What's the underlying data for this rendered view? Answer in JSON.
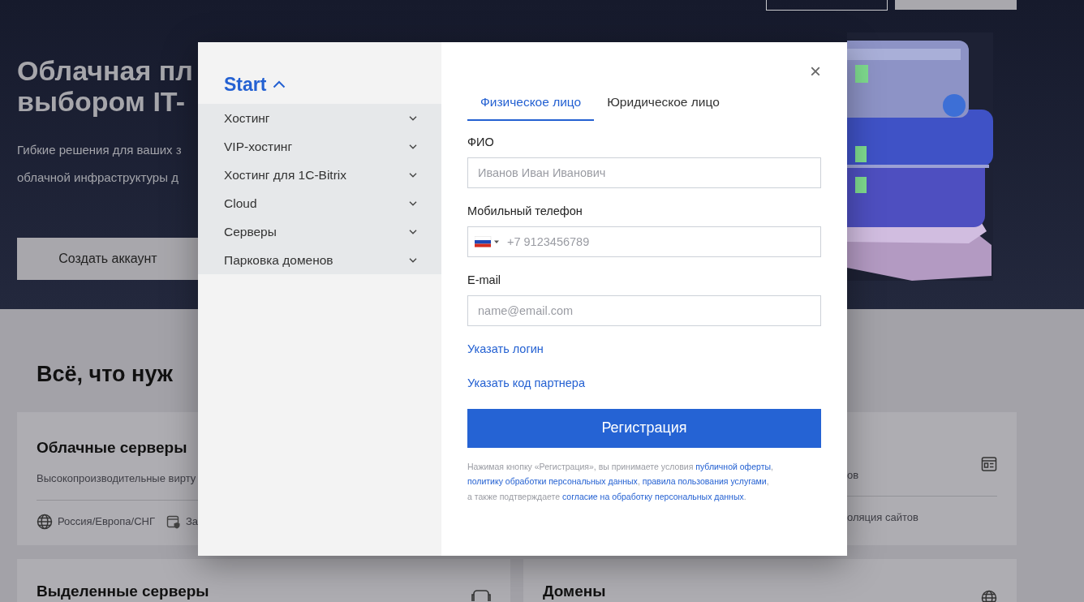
{
  "hero": {
    "title_lines": [
      "Облачная пл",
      "выбором IT-"
    ],
    "text_lines": [
      "Гибкие решения для ваших з",
      "облачной инфраструктуры д"
    ],
    "button": "Создать аккаунт"
  },
  "section": {
    "title": "Всё, что нуж",
    "cards": [
      {
        "title": "Облачные серверы",
        "description": "Высокопроизводительные вирту",
        "features": [
          {
            "text": "Россия/Европа/СНГ"
          },
          {
            "text": "За"
          }
        ]
      },
      {
        "description": "ов",
        "features": [
          {
            "text": "оляция сайтов"
          }
        ]
      },
      {
        "title": "Выделенные серверы"
      },
      {
        "title": "Домены"
      }
    ]
  },
  "modal": {
    "start": {
      "label": "Start",
      "expanded": true
    },
    "menu": [
      {
        "label": "Хостинг",
        "expanded": false
      },
      {
        "label": "VIP-хостинг",
        "expanded": false
      },
      {
        "label": "Хостинг для 1C-Bitrix",
        "expanded": false
      },
      {
        "label": "Cloud",
        "expanded": false
      },
      {
        "label": "Серверы",
        "expanded": false
      },
      {
        "label": "Парковка доменов",
        "expanded": false
      }
    ],
    "close": "×",
    "tabs": [
      {
        "label": "Физическое лицо",
        "selected": true
      },
      {
        "label": "Юридическое лицо",
        "selected": false
      }
    ],
    "fields": [
      {
        "kind": "text",
        "label": "ФИО",
        "placeholder": "Иванов Иван Иванович"
      },
      {
        "kind": "phone",
        "label": "Мобильный телефон",
        "placeholder": "+7 9123456789"
      },
      {
        "kind": "text",
        "label": "E-mail",
        "placeholder": "name@email.com"
      }
    ],
    "links": [
      "Указать логин",
      "Указать код партнера"
    ],
    "submit": "Регистрация",
    "legal_lines": [
      [
        {
          "text": "Нажимая кнопку «Регистрация», вы принимаете условия ",
          "link": false
        },
        {
          "text": "публичной оферты",
          "link": true
        },
        {
          "text": ",",
          "link": false
        }
      ],
      [
        {
          "text": "политику обработки персональных данных",
          "link": true
        },
        {
          "text": ", ",
          "link": false
        },
        {
          "text": "правила пользования услугами",
          "link": true
        },
        {
          "text": ",",
          "link": false
        }
      ],
      [
        {
          "text": "а также подтверждаете ",
          "link": false
        },
        {
          "text": "согласие на обработку персональных данных",
          "link": true
        },
        {
          "text": ".",
          "link": false
        }
      ]
    ]
  }
}
